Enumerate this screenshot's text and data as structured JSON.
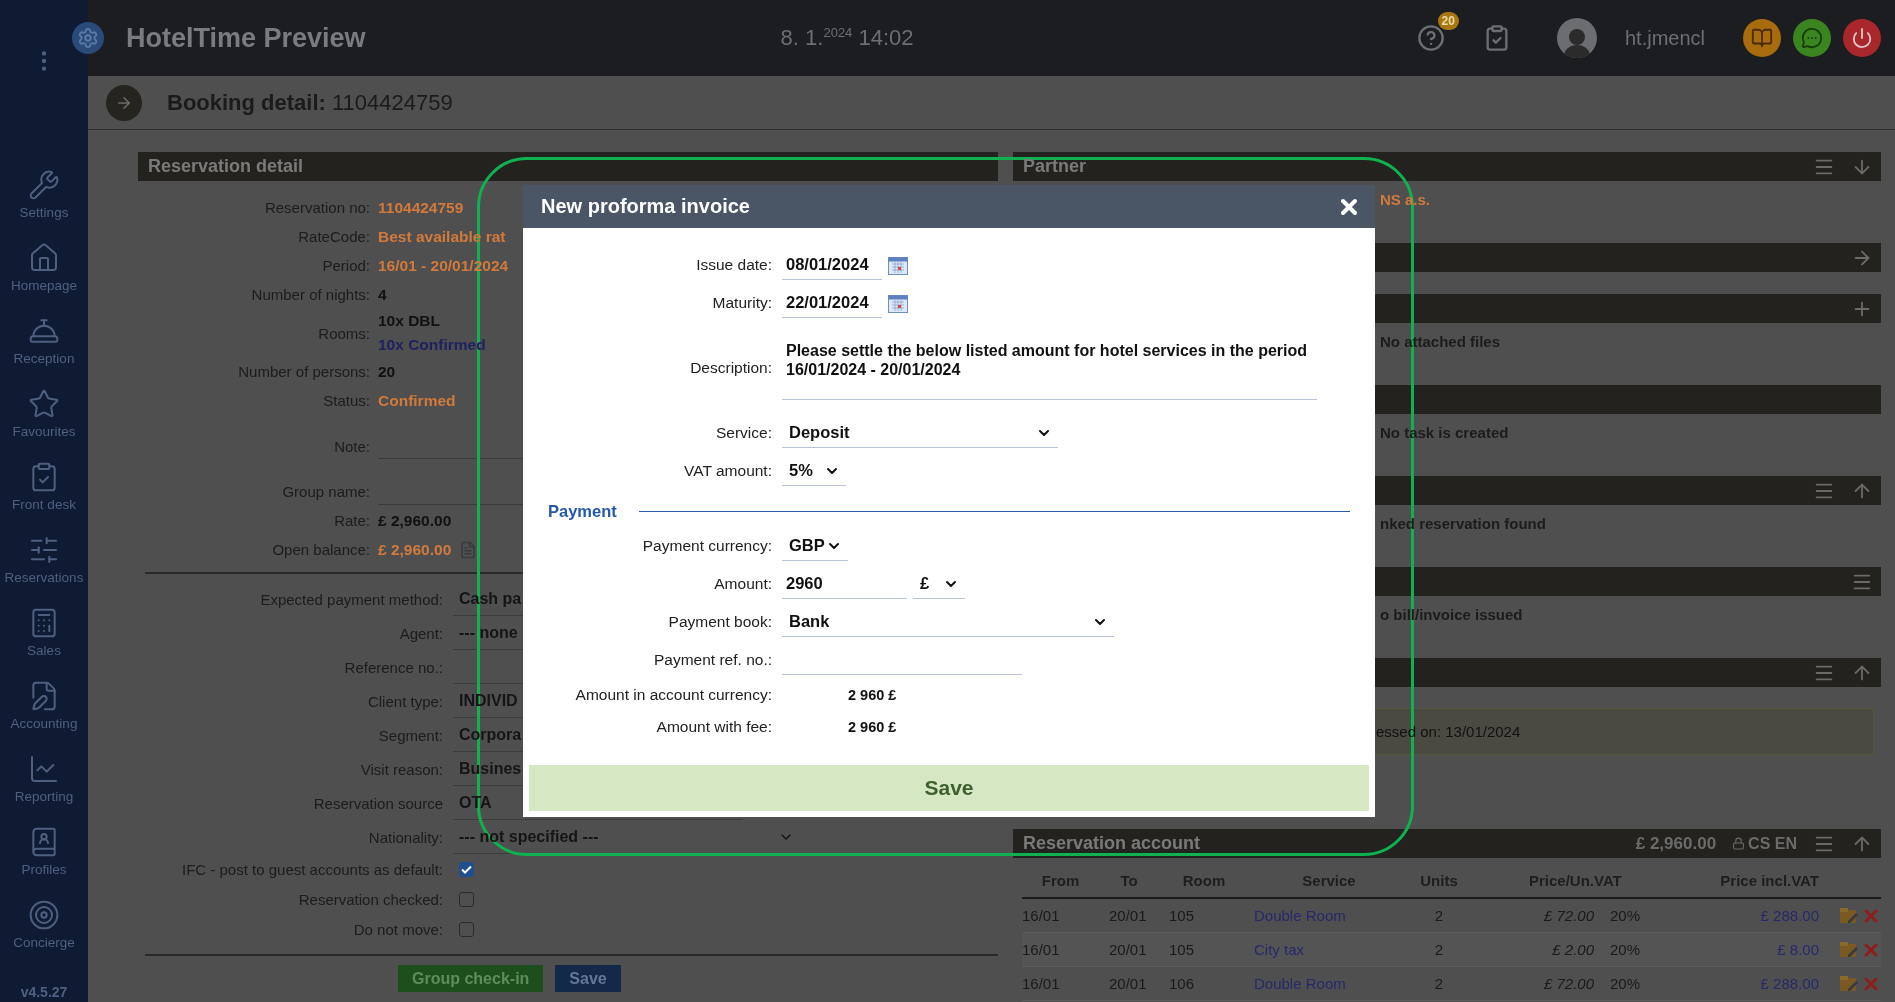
{
  "top_bar": {
    "title": "HotelTime Preview",
    "date": "8. 1.",
    "year": "2024",
    "time": "14:02",
    "help_badge": "20",
    "user": "ht.jmencl"
  },
  "sidebar": {
    "items": [
      {
        "label": "Settings"
      },
      {
        "label": "Homepage"
      },
      {
        "label": "Reception"
      },
      {
        "label": "Favourites"
      },
      {
        "label": "Front desk"
      },
      {
        "label": "Reservations"
      },
      {
        "label": "Sales"
      },
      {
        "label": "Accounting"
      },
      {
        "label": "Reporting"
      },
      {
        "label": "Profiles"
      },
      {
        "label": "Concierge"
      }
    ],
    "version": "v4.5.27"
  },
  "page": {
    "title": "Booking detail:",
    "number": "1104424759"
  },
  "reservation_detail": {
    "title": "Reservation detail",
    "summary": [
      {
        "kind": "text",
        "label": "Reservation no:",
        "lines": [
          {
            "text": "1104424759",
            "kind": "accent"
          }
        ]
      },
      {
        "kind": "text",
        "label": "RateCode:",
        "lines": [
          {
            "text": "Best available rat",
            "kind": "accent"
          }
        ]
      },
      {
        "kind": "text",
        "label": "Period:",
        "lines": [
          {
            "text": "16/01 - 20/01/2024",
            "kind": "accent"
          }
        ]
      },
      {
        "kind": "text",
        "label": "Number of nights:",
        "lines": [
          {
            "text": "4",
            "kind": "plain"
          }
        ]
      },
      {
        "kind": "text",
        "label": "Rooms:",
        "lines": [
          {
            "text": "10x DBL",
            "kind": "plain"
          },
          {
            "text": "10x Confirmed",
            "kind": "link"
          }
        ]
      },
      {
        "kind": "text",
        "label": "Number of persons:",
        "lines": [
          {
            "text": "20",
            "kind": "plain"
          }
        ]
      },
      {
        "kind": "text",
        "label": "Status:",
        "lines": [
          {
            "text": "Confirmed",
            "kind": "accent"
          }
        ]
      },
      {
        "kind": "note",
        "label": "Note:"
      },
      {
        "kind": "field",
        "label": "Group name:"
      },
      {
        "kind": "text",
        "label": "Rate:",
        "lines": [
          {
            "text": "£ 2,960.00",
            "kind": "plain"
          }
        ]
      },
      {
        "kind": "balance",
        "label": "Open balance:",
        "lines": [
          {
            "text": "£ 2,960.00",
            "kind": "accent"
          }
        ]
      }
    ],
    "settings": [
      {
        "kind": "select",
        "label": "Expected payment method:",
        "value": "Cash pa"
      },
      {
        "kind": "select",
        "label": "Agent:",
        "value": "--- none"
      },
      {
        "kind": "input",
        "label": "Reference no.:"
      },
      {
        "kind": "select",
        "label": "Client type:",
        "value": "INDIVID"
      },
      {
        "kind": "select",
        "label": "Segment:",
        "value": "Corpora"
      },
      {
        "kind": "select",
        "label": "Visit reason:",
        "value": "Busines"
      },
      {
        "kind": "select",
        "label": "Reservation source",
        "value": "OTA"
      },
      {
        "kind": "dropdown",
        "label": "Nationality:",
        "value": "--- not specified ---"
      },
      {
        "kind": "checkbox",
        "label": "IFC - post to guest accounts as default:",
        "checked": true
      },
      {
        "kind": "checkbox",
        "label": "Reservation checked:",
        "checked": false
      },
      {
        "kind": "checkbox",
        "label": "Do not move:",
        "checked": false
      }
    ],
    "buttons": [
      {
        "label": "Group check-in",
        "kind": "primary"
      },
      {
        "label": "Save",
        "kind": "secondary"
      }
    ]
  },
  "right_panels": [
    {
      "title": "Partner",
      "text": "NS a.s.",
      "kind": "accent"
    },
    {
      "kind": "empty"
    },
    {
      "text": "No attached files",
      "kind": "muted"
    },
    {
      "text": "No task is created",
      "kind": "muted"
    },
    {
      "text": "nked reservation found",
      "kind": "muted"
    },
    {
      "text": "o bill/invoice issued",
      "kind": "muted"
    },
    {
      "notice": "essed on: 13/01/2024",
      "kind": "notice"
    }
  ],
  "account": {
    "title": "Reservation account",
    "total": "£ 2,960.00",
    "languages": "CS EN",
    "columns": [
      "From",
      "To",
      "Room",
      "Service",
      "Units",
      "Price/Un.",
      "VAT",
      "Price incl.VAT"
    ],
    "rows": [
      {
        "from": "16/01",
        "to": "20/01",
        "room": "105",
        "service": "Double Room",
        "units": "2",
        "price": "£ 72.00",
        "vat": "20%",
        "total": "£ 288.00"
      },
      {
        "from": "16/01",
        "to": "20/01",
        "room": "105",
        "service": "City tax",
        "units": "2",
        "price": "£ 2.00",
        "vat": "20%",
        "total": "£ 8.00"
      },
      {
        "from": "16/01",
        "to": "20/01",
        "room": "106",
        "service": "Double Room",
        "units": "2",
        "price": "£ 72.00",
        "vat": "20%",
        "total": "£ 288.00"
      }
    ]
  },
  "modal": {
    "title": "New proforma invoice",
    "fields": [
      {
        "kind": "date",
        "label": "Issue date:",
        "value": "08/01/2024"
      },
      {
        "kind": "date",
        "label": "Maturity:",
        "value": "22/01/2024"
      },
      {
        "kind": "textarea",
        "label": "Description:",
        "value": "Please settle the below listed amount for hotel services in the period 16/01/2024 - 20/01/2024"
      },
      {
        "kind": "select",
        "label": "Service:",
        "value": "Deposit"
      },
      {
        "kind": "select",
        "label": "VAT amount:",
        "value": "5%"
      },
      {
        "kind": "section",
        "label": "Payment"
      },
      {
        "kind": "select",
        "label": "Payment currency:",
        "value": "GBP"
      },
      {
        "kind": "amount",
        "label": "Amount:",
        "value": "2960",
        "currency": "£"
      },
      {
        "kind": "select",
        "label": "Payment book:",
        "value": "Bank"
      },
      {
        "kind": "input",
        "label": "Payment ref. no.:"
      },
      {
        "kind": "readout",
        "label": "Amount in account currency:",
        "value": "2 960 £"
      },
      {
        "kind": "readout",
        "label": "Amount with fee:",
        "value": "2 960 £"
      }
    ],
    "save_button": "Save"
  }
}
